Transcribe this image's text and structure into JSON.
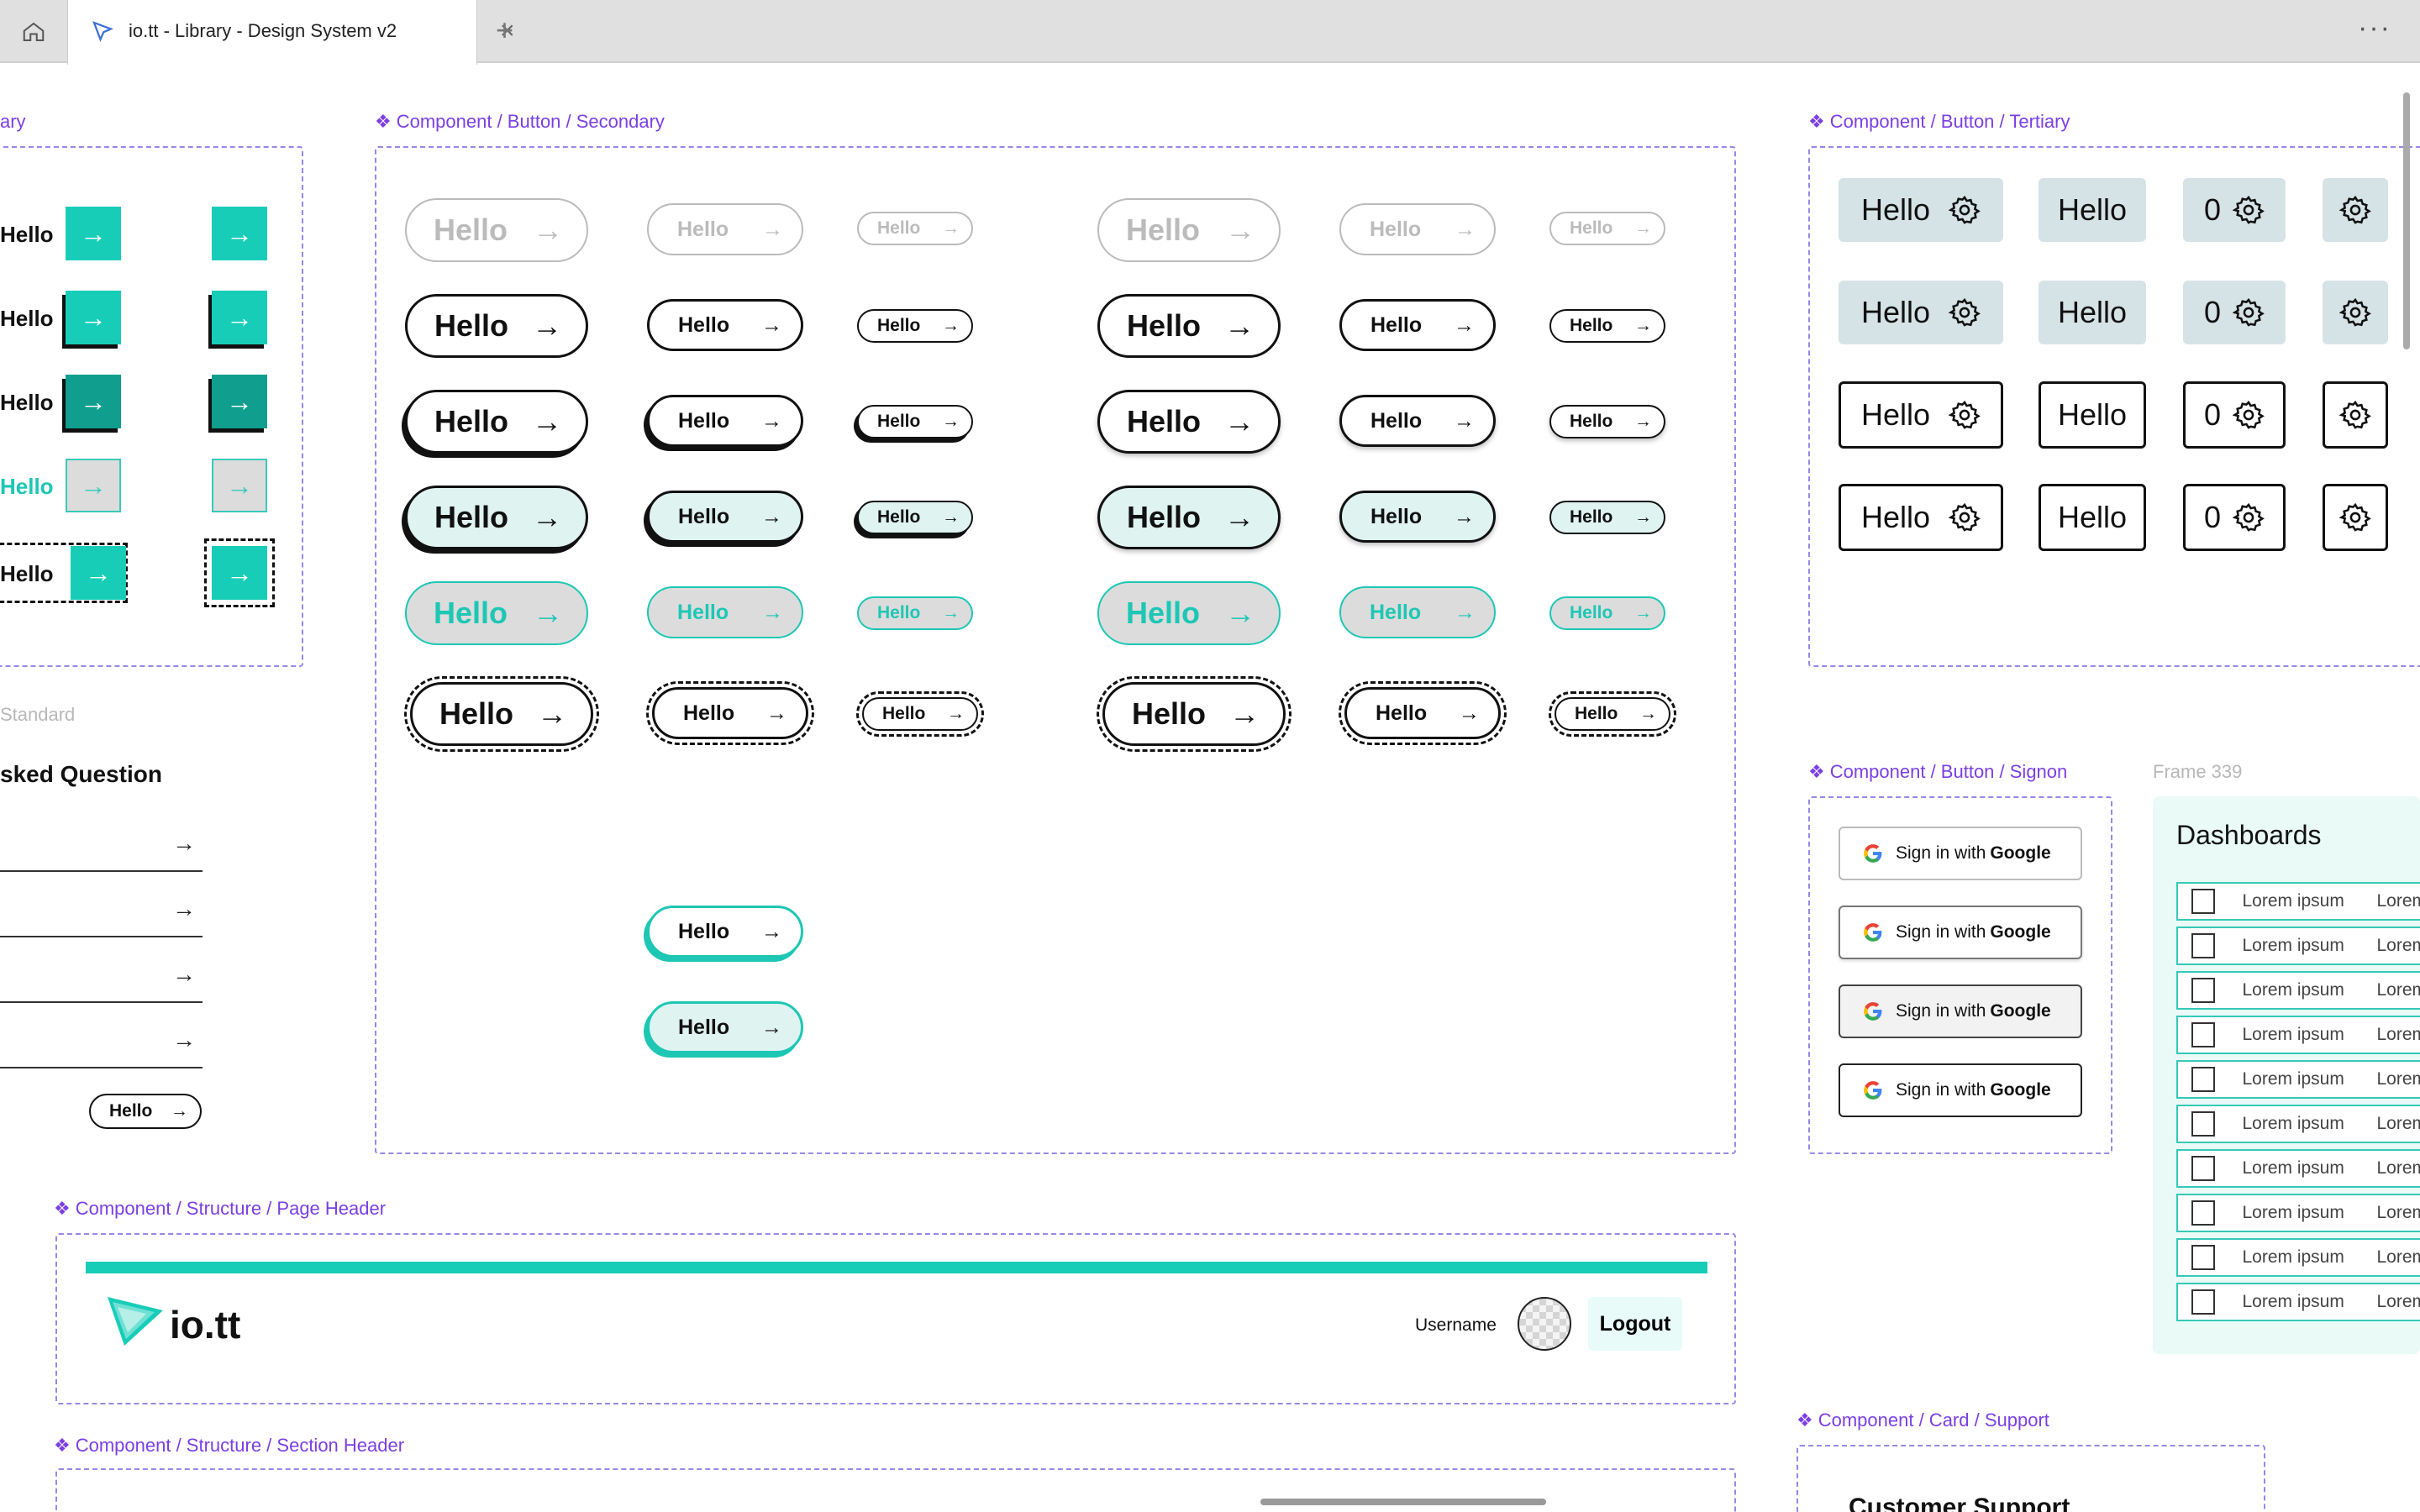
{
  "browser": {
    "tab_title": "io.tt - Library - Design System v2"
  },
  "frames": {
    "primary_partial": "ary",
    "secondary": "Component / Button / Secondary",
    "tertiary": "Component / Button / Tertiary",
    "signon": "Component / Button / Signon",
    "frame339": "Frame 339",
    "page_header": "Component / Structure / Page Header",
    "section_header": "Component / Structure / Section Header",
    "card_support": "Component / Card / Support",
    "standard_partial": "Standard"
  },
  "button_text": "Hello",
  "arrow": "→",
  "faq_title_partial": "sked Question",
  "tertiary_zero": "0",
  "signon": {
    "prefix": "Sign in with",
    "brand": "Google"
  },
  "dashboards": {
    "title": "Dashboards",
    "col1": "Lorem ipsum",
    "col2": "Lorem"
  },
  "header": {
    "logo": "io.tt",
    "username": "Username",
    "logout": "Logout"
  },
  "card": {
    "title_partial": "Customer Support"
  },
  "colors": {
    "accent": "#18cdb8",
    "frame_border": "#9b86e6",
    "label": "#7b3fe4"
  }
}
